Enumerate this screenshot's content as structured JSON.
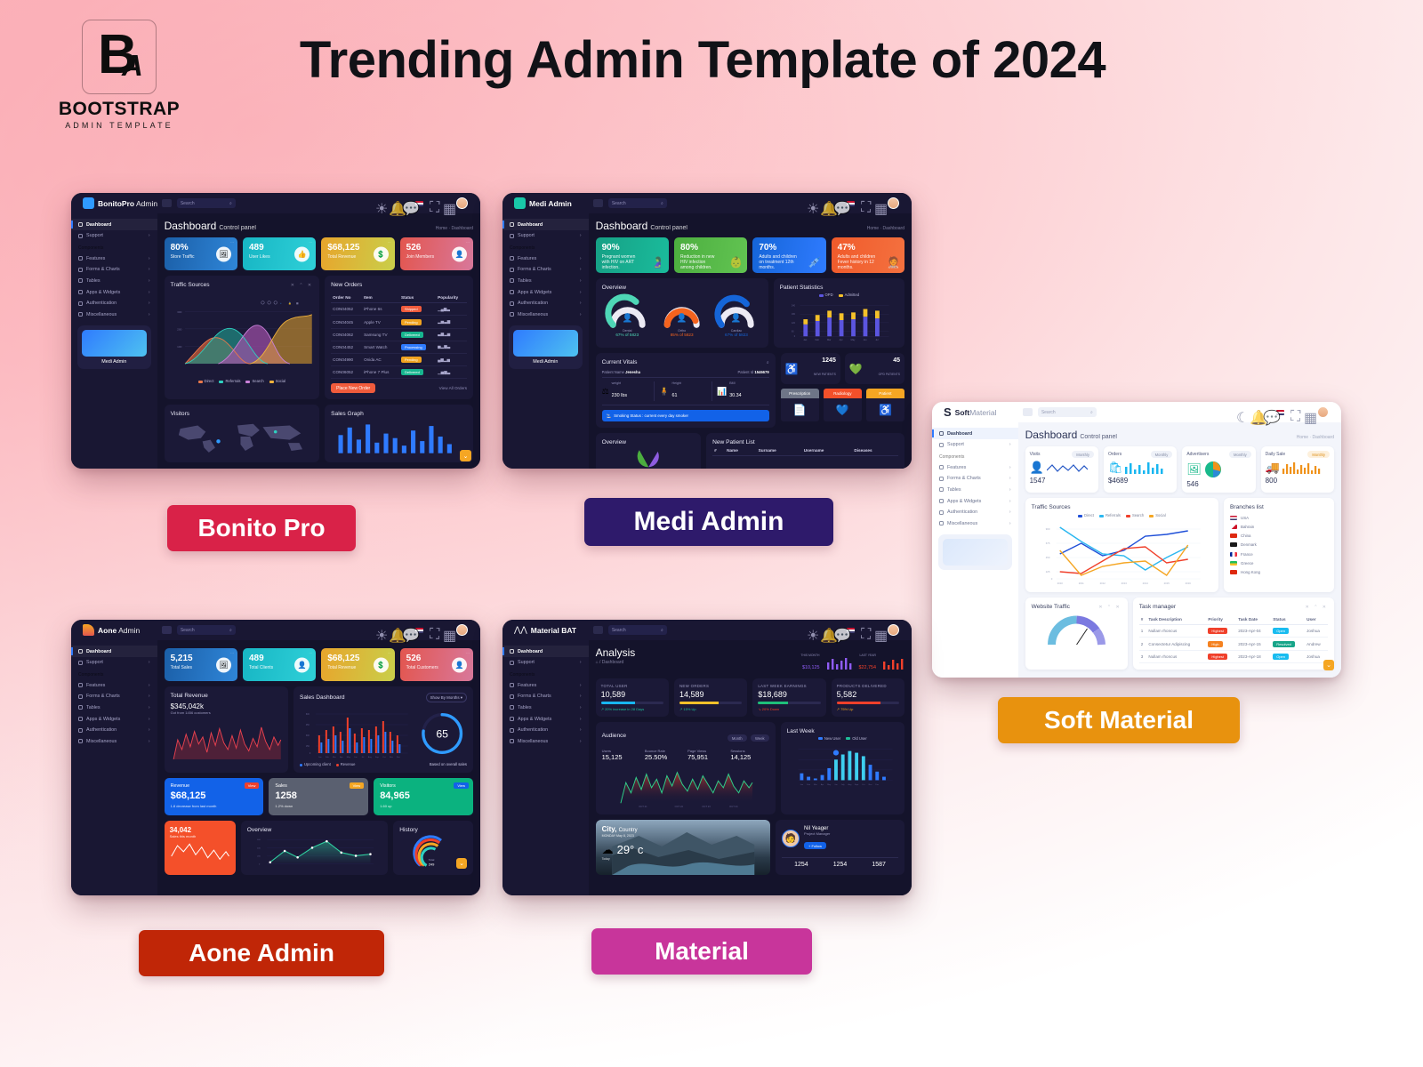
{
  "brand": {
    "logo_letter_main": "B",
    "logo_letter_sub": "A",
    "name": "BOOTSTRAP",
    "tagline": "ADMIN TEMPLATE"
  },
  "header": {
    "title": "Trending Admin Template of 2024"
  },
  "common": {
    "search_placeholder": "Search",
    "nav_dashboard": "Dashboard",
    "nav_support": "Support",
    "nav_section_components": "Components",
    "nav_features": "Features",
    "nav_forms_charts": "Forms & Charts",
    "nav_tables": "Tables",
    "nav_apps_widgets": "Apps & Widgets",
    "nav_authentication": "Authentication",
    "nav_miscellaneous": "Miscellaneous",
    "page_title": "Dashboard",
    "page_subtitle": "Control panel",
    "breadcrumb": "Home  ·  Dashboard",
    "caret": "›",
    "tools": "✕ ⌃ ✕"
  },
  "templates": [
    {
      "id": "bonito",
      "chip_label": "Bonito Pro",
      "chip_color": "#d92248",
      "brand_name_bold": "BonitoPro",
      "brand_name_thin": " Admin",
      "brand_mark_color": "#2f9bff",
      "promo_label": "Medi Admin",
      "stats": [
        {
          "value": "80%",
          "label": "Store Traffic",
          "grad": "linear-gradient(100deg,#1b5fa8,#2f86d8)",
          "icon": "🖼"
        },
        {
          "value": "489",
          "label": "User Likes",
          "grad": "linear-gradient(100deg,#17b6c4,#2fd0d8)",
          "icon": "👍"
        },
        {
          "value": "$68,125",
          "label": "Total Revenue",
          "grad": "linear-gradient(100deg,#e8a52c,#c9cf4a)",
          "icon": "💰"
        },
        {
          "value": "526",
          "label": "Join Members",
          "grad": "linear-gradient(100deg,#e3564f,#d8789b)",
          "icon": "👤"
        }
      ],
      "traffic_panel": {
        "title": "Traffic Sources"
      },
      "orders_panel": {
        "title": "New Orders",
        "columns": [
          "Order No",
          "Item",
          "Status",
          "Popularity"
        ],
        "rows": [
          {
            "order": "CON04052",
            "item": "iPhone 6s",
            "status": "Shipped",
            "status_color": "#f05b3c"
          },
          {
            "order": "CON04045",
            "item": "Apple TV",
            "status": "Pending",
            "status_color": "#f0a320"
          },
          {
            "order": "CON04062",
            "item": "Samsung TV",
            "status": "Delivered",
            "status_color": "#17b58f"
          },
          {
            "order": "CON04452",
            "item": "Smart Watch",
            "status": "Processing",
            "status_color": "#2f7bff"
          },
          {
            "order": "CON04990",
            "item": "Onida AC",
            "status": "Pending",
            "status_color": "#f0a320"
          },
          {
            "order": "CON06052",
            "item": "iPhone 7 Plus",
            "status": "Delivered",
            "status_color": "#17b58f"
          }
        ],
        "primary_button": "Place New Order",
        "link": "View All Orders"
      },
      "visitors_panel": {
        "title": "Visitors"
      },
      "sales_panel": {
        "title": "Sales Graph"
      }
    },
    {
      "id": "medi",
      "chip_label": "Medi Admin",
      "chip_color": "#2e1a6b",
      "brand_name_bold": "Medi Admin",
      "brand_name_thin": "",
      "brand_mark_color": "#19c7a8",
      "promo_label": "Medi Admin",
      "stats": [
        {
          "value": "90%",
          "label": "Pregnant women with HIV on ART infection.",
          "grad": "linear-gradient(100deg,#16a085,#1abc9c)",
          "icon": "🤰"
        },
        {
          "value": "80%",
          "label": "Reduction in new HIV infection among children.",
          "grad": "linear-gradient(100deg,#4cae3f,#62c452)",
          "icon": "👶"
        },
        {
          "value": "70%",
          "label": "Adults and children on treatment 12th months.",
          "grad": "linear-gradient(100deg,#1565d8,#2f7bff)",
          "icon": "💉"
        },
        {
          "value": "47%",
          "label": "Adults and children Fever history in 12 months.",
          "grad": "linear-gradient(100deg,#f05a2b,#f4713f)",
          "icon": "🧑‍⚕️"
        }
      ],
      "overview_panel": {
        "title": "Overview",
        "gauges": [
          {
            "name": "Dental",
            "value": "67% of 5823",
            "color": "#4ed6b6"
          },
          {
            "name": "Ortho",
            "value": "85% of 5823",
            "color": "#f4631e"
          },
          {
            "name": "Cardiac",
            "value": "67% of 5823",
            "color": "#1565d8"
          }
        ]
      },
      "patient_stats_panel": {
        "title": "Patient Statistics",
        "legend": [
          "OPD",
          "Admitted"
        ],
        "months": [
          "Jan",
          "Feb",
          "Mar",
          "Apr",
          "May",
          "Jun",
          "Jul"
        ]
      },
      "vitals_panel": {
        "title": "Current Vitals",
        "patient_name_label": "Patient Name",
        "patient_name": "Jenesha",
        "patient_id_label": "Patient Id",
        "patient_id": "1546679",
        "metrics": [
          {
            "label": "weight",
            "value": "230 lbs"
          },
          {
            "label": "Height",
            "value": "61"
          },
          {
            "label": "BMI",
            "value": "30.34"
          }
        ],
        "smoking": "Smoking Status : current every day smoker"
      },
      "counters": [
        {
          "value": "1245",
          "label": "NEW PATIENTS",
          "color": "#1fbf9a"
        },
        {
          "value": "45",
          "label": "OPD PATIENTS",
          "color": "#2f7bff"
        }
      ],
      "tiles": [
        {
          "label": "Prescription",
          "color": "#6e7587",
          "icon": "📄"
        },
        {
          "label": "Radiology",
          "color": "#f4502a",
          "icon": "💙"
        },
        {
          "label": "Patient",
          "color": "#f5a623",
          "icon": "♿"
        }
      ],
      "bottom_overview": {
        "title": "Overview"
      },
      "patient_list": {
        "title": "New Patient List",
        "columns": [
          "#",
          "Name",
          "Surname",
          "Username",
          "Diseases"
        ]
      }
    },
    {
      "id": "soft",
      "chip_label": "Soft Material",
      "chip_color": "#e8920e",
      "brand_name_bold": "Soft",
      "brand_name_thin": "Material",
      "brand_mark_color": "#20253a",
      "stats": [
        {
          "value": "1547",
          "label": "Visits",
          "badge": "Monthly",
          "color": "#2255c4",
          "spark": "line"
        },
        {
          "value": "$4689",
          "label": "Orders",
          "badge": "Monthly",
          "color": "#18b6f0",
          "spark": "bars"
        },
        {
          "value": "546",
          "label": "Advertisers",
          "badge": "Monthly",
          "color": "#19b98b",
          "spark": "pie"
        },
        {
          "value": "800",
          "label": "Daily Sale",
          "badge": "Monthly",
          "color": "#f0921a",
          "spark": "bars2"
        }
      ],
      "traffic_panel": {
        "title": "Traffic Sources",
        "legend": [
          {
            "name": "Direct",
            "color": "#1f4fd8"
          },
          {
            "name": "Referrals",
            "color": "#2ab7f0"
          },
          {
            "name": "Search",
            "color": "#f0402b"
          },
          {
            "name": "Social",
            "color": "#f5a623"
          }
        ],
        "x_ticks": [
          "2010",
          "2011",
          "2012",
          "2013",
          "2014",
          "2015",
          "2016"
        ],
        "y_ticks": [
          "900",
          "675",
          "450",
          "225",
          "0"
        ]
      },
      "branches_panel": {
        "title": "Branches list",
        "items": [
          "USA",
          "Bahrain",
          "China",
          "Denmark",
          "France",
          "Greece",
          "Hong Kong"
        ]
      },
      "website_traffic_panel": {
        "title": "Website Traffic"
      },
      "task_panel": {
        "title": "Task manager",
        "columns": [
          "#",
          "Task Description",
          "Priority",
          "Task Date",
          "Status",
          "User"
        ],
        "rows": [
          {
            "n": "1",
            "desc": "Nullam rhoncus",
            "priority": "Highest",
            "priority_color": "#f0402b",
            "date": "2023-Apr-04",
            "status": "Open",
            "status_color": "#19bcf0",
            "user": "Joshua"
          },
          {
            "n": "2",
            "desc": "Consectetur Adipiscing",
            "priority": "High",
            "priority_color": "#f58220",
            "date": "2023-Apr-15",
            "status": "Resolved",
            "status_color": "#17a589",
            "user": "Andrew"
          },
          {
            "n": "3",
            "desc": "Nullam rhoncus",
            "priority": "Highest",
            "priority_color": "#f0402b",
            "date": "2023-Apr-18",
            "status": "Open",
            "status_color": "#19bcf0",
            "user": "Joshua"
          }
        ]
      }
    },
    {
      "id": "aone",
      "chip_label": "Aone Admin",
      "chip_color": "#c02607",
      "brand_name_bold": "Aone",
      "brand_name_thin": " Admin",
      "brand_mark_color": "#f5a623",
      "stats": [
        {
          "value": "5,215",
          "label": "Total Sales",
          "grad": "linear-gradient(100deg,#1b5fa8,#2f86d8)",
          "icon": "🖼"
        },
        {
          "value": "489",
          "label": "Total Clients",
          "grad": "linear-gradient(100deg,#17b6c4,#2fd0d8)",
          "icon": "👤"
        },
        {
          "value": "$68,125",
          "label": "Total Revenue",
          "grad": "linear-gradient(100deg,#e8a52c,#c9cf4a)",
          "icon": "💰"
        },
        {
          "value": "526",
          "label": "Total Customers",
          "grad": "linear-gradient(100deg,#e3564f,#d8789b)",
          "icon": "👤"
        }
      ],
      "revenue_panel": {
        "title": "Total Revenue",
        "amount": "$345,042k",
        "sub": "Got from 1456 customers"
      },
      "sales_panel": {
        "title": "Sales Dashboard",
        "dropdown": "Show By Months",
        "gauge_value": "65",
        "legend": [
          {
            "name": "Upcoming client",
            "color": "#2f7bff"
          },
          {
            "name": "Revenue",
            "color": "#f0402b"
          }
        ],
        "note": "Based on overall sales",
        "months": [
          "Jan",
          "Feb",
          "Mar",
          "Apr",
          "May",
          "Jun",
          "Jul",
          "Aug",
          "Sep",
          "Oct",
          "Nov",
          "Dec"
        ]
      },
      "kpis": [
        {
          "title": "Revenue",
          "value": "$68,125",
          "note": "1.8 decrease from last month",
          "bg": "#1262e8",
          "btn": "View",
          "btn_color": "#f0402b"
        },
        {
          "title": "Sales",
          "value": "1258",
          "note": "1.2% down",
          "bg": "#5a6070",
          "btn": "View",
          "btn_color": "#f5a623"
        },
        {
          "title": "Visitors",
          "value": "84,965",
          "note": "1.60 up",
          "bg": "#0bb27f",
          "btn": "View",
          "btn_color": "#1262e8"
        }
      ],
      "sales_month": {
        "value": "34,042",
        "label": "Sales this month"
      },
      "overview_panel": {
        "title": "Overview"
      },
      "history_panel": {
        "title": "History",
        "center_label": "Total",
        "center_value": "249"
      }
    },
    {
      "id": "material",
      "chip_label": "Material",
      "chip_color": "#c8359b",
      "brand_name_bold": "Material BAT",
      "brand_name_thin": "",
      "brand_mark_color": "#ffffff",
      "page_title": "Analysis",
      "breadcrumb": "Dashboard",
      "mini_stats": [
        {
          "label": "THIS MONTH",
          "value": "$10,125",
          "color": "#8f5cf5"
        },
        {
          "label": "LAST YEAR",
          "value": "$22,754",
          "color": "#f0402b"
        }
      ],
      "stats": [
        {
          "label": "TOTAL USER",
          "value": "10,589",
          "bar": "#18b6f0",
          "note": "20% increase in 28 Days",
          "note_color": "#1fbf9a"
        },
        {
          "label": "NEW ORDERS",
          "value": "14,589",
          "bar": "#f5c12a",
          "note": "15% Up",
          "note_color": "#1fbf9a"
        },
        {
          "label": "LAST WEEK EARNINGS",
          "value": "$18,689",
          "bar": "#1fbf7a",
          "note": "20% Down",
          "note_color": "#f0402b"
        },
        {
          "label": "PRODUCTS DELIVERED",
          "value": "5,582",
          "bar": "#f0402b",
          "note": "75% Up",
          "note_color": "#f5a623"
        }
      ],
      "audience_panel": {
        "title": "Audience",
        "buttons": [
          "Month",
          "Week"
        ],
        "metrics": [
          {
            "label": "Users",
            "value": "15,125"
          },
          {
            "label": "Bounce Rate",
            "value": "25.50%"
          },
          {
            "label": "Page Views",
            "value": "75,951"
          },
          {
            "label": "Sessions",
            "value": "14,125"
          }
        ],
        "x_ticks": [
          "OCT 21",
          "OCT 22",
          "OCT 23",
          "OCT 24"
        ]
      },
      "lastweek_panel": {
        "title": "Last Week",
        "legend": [
          {
            "name": "New User",
            "color": "#2f7bff"
          },
          {
            "name": "Old User",
            "color": "#1fbf9a"
          }
        ],
        "months": [
          "Jan",
          "Feb",
          "Mar",
          "Apr",
          "May",
          "Jun",
          "July",
          "Aug",
          "Sept",
          "Oct",
          "Nov",
          "Dec"
        ]
      },
      "weather": {
        "city": "City,",
        "country": "Country",
        "date": "MONDAY  May 8, 2023",
        "temp": "29° c",
        "condition": "Today"
      },
      "profile": {
        "name": "Nil Yeager",
        "role": "Project Manager",
        "button": "Follow",
        "stats": [
          "1254",
          "1254",
          "1587"
        ]
      }
    }
  ]
}
